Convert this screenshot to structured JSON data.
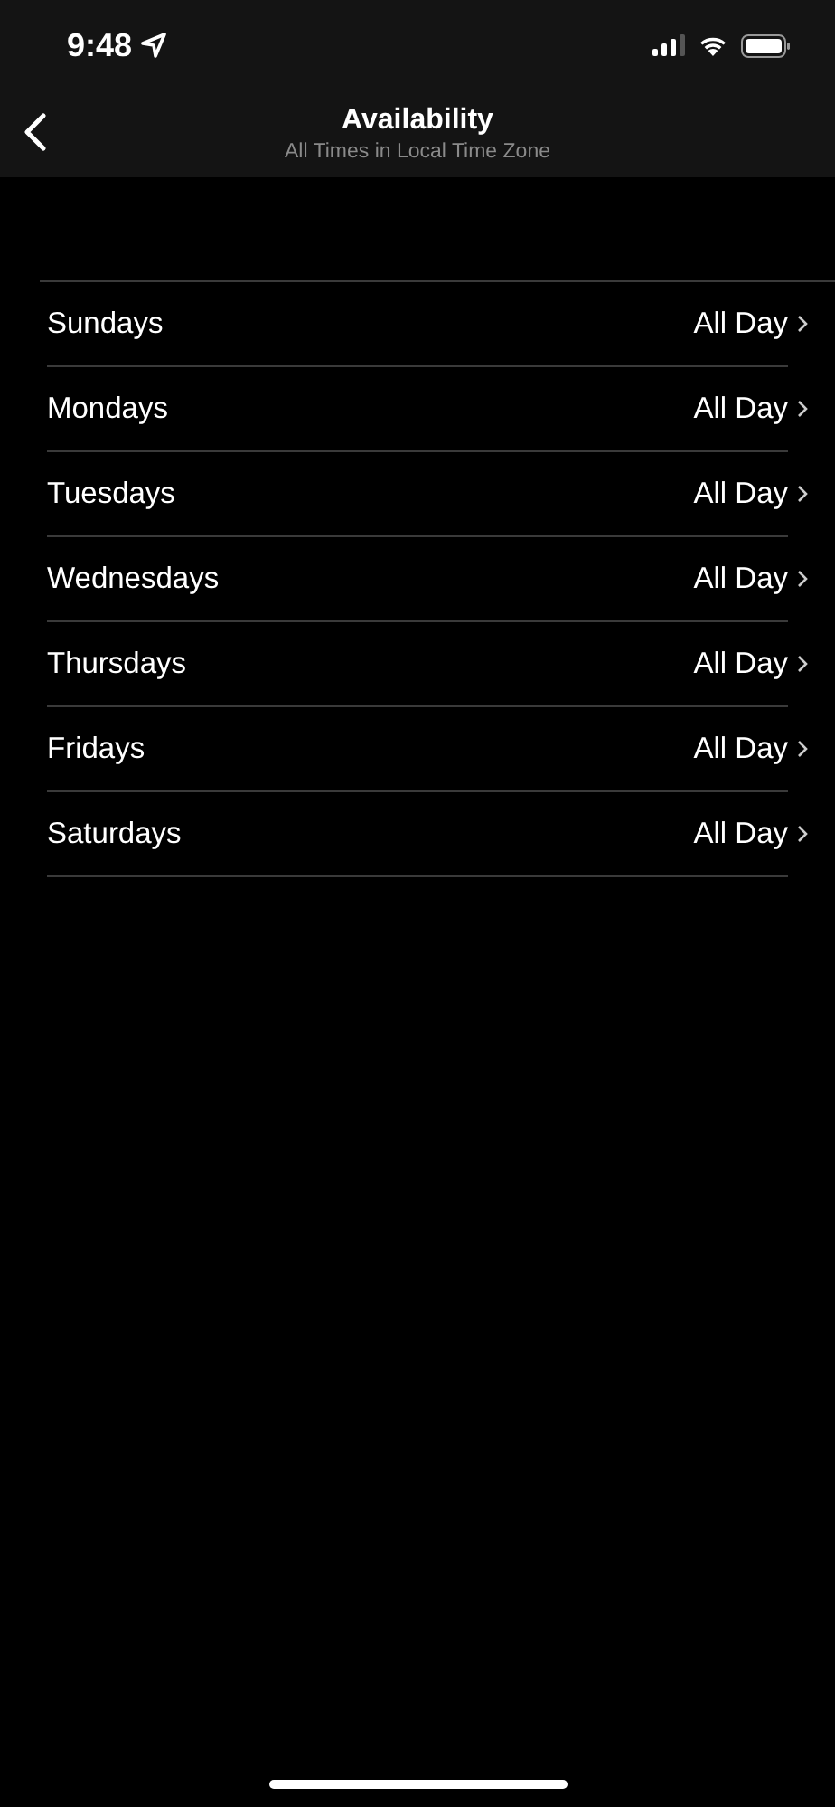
{
  "status_bar": {
    "time": "9:48"
  },
  "nav": {
    "title": "Availability",
    "subtitle": "All Times in Local Time Zone"
  },
  "days": [
    {
      "label": "Sundays",
      "value": "All Day"
    },
    {
      "label": "Mondays",
      "value": "All Day"
    },
    {
      "label": "Tuesdays",
      "value": "All Day"
    },
    {
      "label": "Wednesdays",
      "value": "All Day"
    },
    {
      "label": "Thursdays",
      "value": "All Day"
    },
    {
      "label": "Fridays",
      "value": "All Day"
    },
    {
      "label": "Saturdays",
      "value": "All Day"
    }
  ]
}
